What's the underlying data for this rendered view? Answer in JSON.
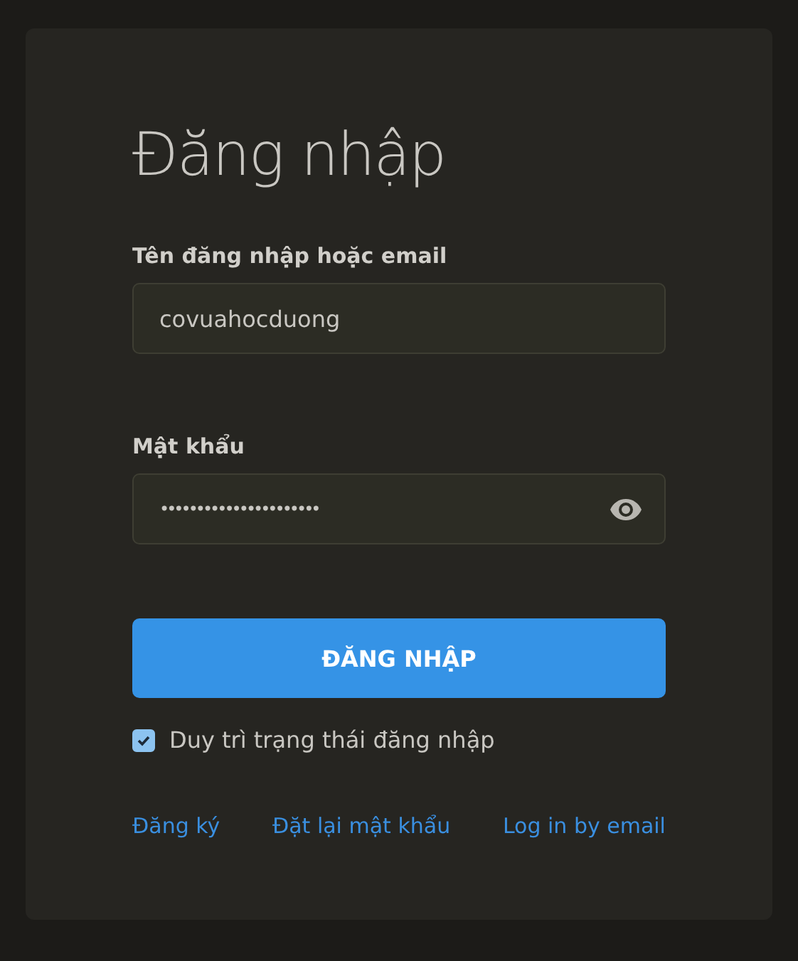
{
  "title": "Đăng nhập",
  "fields": [
    {
      "label": "Tên đăng nhập hoặc email",
      "value": "covuahocduong",
      "kind": "text"
    },
    {
      "label": "Mật khẩu",
      "value": "••••••••••••••••••••••",
      "kind": "password"
    }
  ],
  "submit": "ĐĂNG NHẬP",
  "remember": {
    "label": "Duy trì trạng thái đăng nhập",
    "checked": true
  },
  "links": [
    "Đăng ký",
    "Đặt lại mật khẩu",
    "Log in by email"
  ]
}
